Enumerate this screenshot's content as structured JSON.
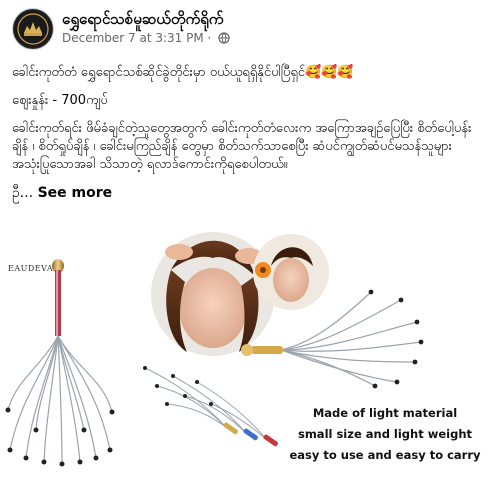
{
  "post": {
    "page_name": "ရွှေရောင်သစ်မူဆယ်တိုက်ရိုက်",
    "timestamp": "December 7 at 3:31 PM",
    "separator": "·",
    "lines": {
      "line1": "ခေါင်းကုတ်တံ   ရွှေရောင်သစ်ဆိုင်ခွဲတိုင်းမှာ ဝယ်ယူရရှိနိုင်ပါပြီရှင်🥰🥰🥰",
      "line2": "ဈေးနှုန်း - 700ကျပ်",
      "line3": "ခေါင်းကုတ်ရင်း ဖိမ်ခံချင်တဲ့သူတွေအတွက် ခေါင်းကုတ်တံလေးက အကြောအချဉ်ပြေပြီး စိတ်ပေါ့ပန်းချိန် ၊ စိတ်ရှုပ်ချိန် ၊ ခေါင်းမကြည်ချိန် တွေမှာ စိတ်သက်သာစေပြီး ဆံပင်ကျွတ်ဆံပင်မသန်သူများ အသုံးပြုသောအခါ သိသာတဲ့ ရလာဒ်ကောင်းကိုရစေပါတယ်။",
      "line4_prefix": "ဦ...",
      "see_more": "See more"
    }
  },
  "image": {
    "brand": "EAUDEVA",
    "caption": [
      "Made of light material",
      "small size and light weight",
      "easy to use and easy to carry"
    ]
  },
  "colors": {
    "text": "#050505",
    "meta": "#65676b",
    "gold": "#c9a24a",
    "chrome": "#9aa4ad"
  },
  "icons": {
    "privacy": "globe-icon",
    "avatar": "page-logo"
  }
}
